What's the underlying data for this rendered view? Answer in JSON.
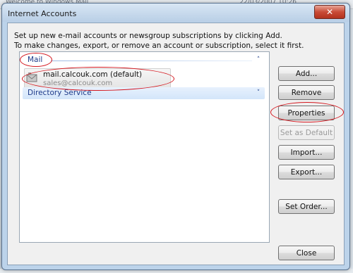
{
  "background": {
    "title_left": "Welcome to Windows Mail",
    "title_right": "22/03/2007 10:26"
  },
  "dialog": {
    "title": "Internet Accounts",
    "close_glyph": "✕",
    "intro_line1": "Set up new e-mail accounts or newsgroup subscriptions by clicking Add.",
    "intro_line2": "To make changes, export, or remove an account or subscription, select it first."
  },
  "accounts": {
    "groups": [
      {
        "label": "Mail",
        "chevron": "˄",
        "expanded": true
      },
      {
        "label": "Directory Service",
        "chevron": "˅",
        "expanded": false
      }
    ],
    "items": [
      {
        "name": "mail.calcouk.com (default)",
        "email": "sales@calcouk.com",
        "icon": "mail-account-icon"
      }
    ]
  },
  "buttons": {
    "add": "Add...",
    "remove": "Remove",
    "properties": "Properties",
    "set_default": "Set as Default",
    "import": "Import...",
    "export": "Export...",
    "set_order": "Set Order...",
    "close": "Close"
  },
  "colors": {
    "annotation": "#d4151c",
    "group_header_text": "#1e3b8a",
    "title_close": "#c94b36"
  }
}
